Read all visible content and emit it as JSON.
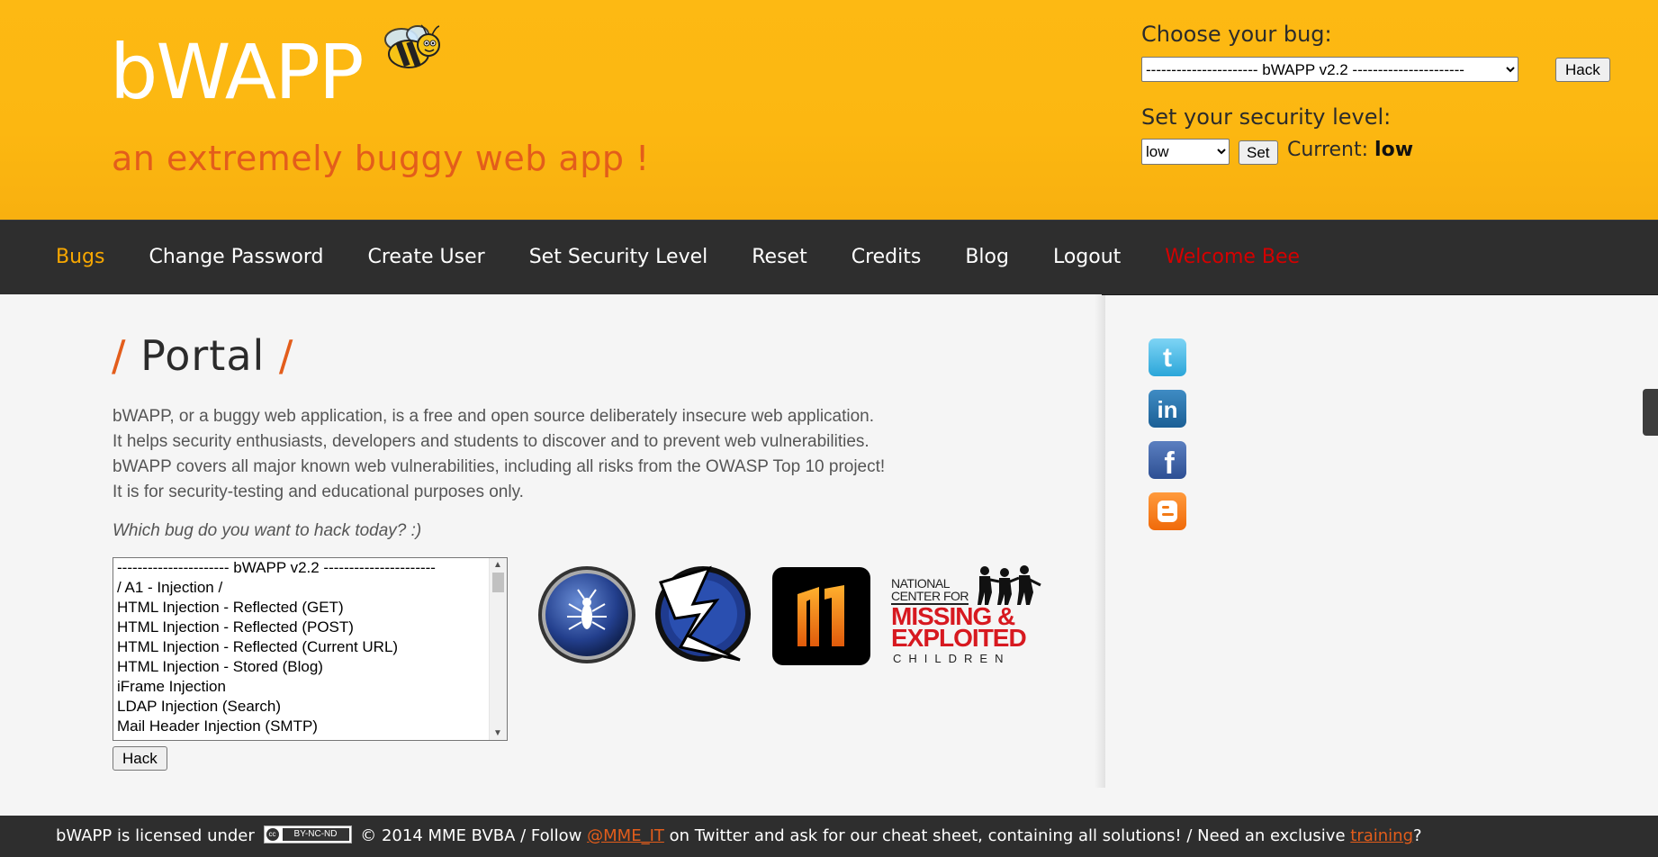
{
  "header": {
    "logo_text": "bWAPP",
    "tagline": "an extremely buggy web app !",
    "choose_label": "Choose your bug:",
    "bug_select_value": "---------------------- bWAPP v2.2 ----------------------",
    "hack_label": "Hack",
    "security_label": "Set your security level:",
    "security_select_value": "low",
    "set_label": "Set",
    "current_label": "Current:",
    "current_value": "low"
  },
  "nav": {
    "items": [
      {
        "label": "Bugs",
        "state": "active"
      },
      {
        "label": "Change Password"
      },
      {
        "label": "Create User"
      },
      {
        "label": "Set Security Level"
      },
      {
        "label": "Reset"
      },
      {
        "label": "Credits"
      },
      {
        "label": "Blog"
      },
      {
        "label": "Logout"
      },
      {
        "label": "Welcome Bee",
        "state": "welcome"
      }
    ]
  },
  "main": {
    "title_slash_left": "/",
    "title": "Portal",
    "title_slash_right": "/",
    "description": [
      "bWAPP, or a buggy web application, is a free and open source deliberately insecure web application.",
      "It helps security enthusiasts, developers and students to discover and to prevent web vulnerabilities.",
      "bWAPP covers all major known web vulnerabilities, including all risks from the OWASP Top 10 project!",
      "It is for security-testing and educational purposes only."
    ],
    "question": "Which bug do you want to hack today? :)",
    "bug_list": [
      "---------------------- bWAPP v2.2 ----------------------",
      "/ A1 - Injection /",
      "HTML Injection - Reflected (GET)",
      "HTML Injection - Reflected (POST)",
      "HTML Injection - Reflected (Current URL)",
      "HTML Injection - Stored (Blog)",
      "iFrame Injection",
      "LDAP Injection (Search)",
      "Mail Header Injection (SMTP)"
    ],
    "hack_label": "Hack",
    "ncmec_text": {
      "line1": "NATIONAL",
      "line2": "CENTER FOR",
      "line3": "MISSING &",
      "line4": "EXPLOITED",
      "line5": "CHILDREN"
    }
  },
  "footer": {
    "text_before": "bWAPP is licensed under",
    "cc_text": "BY-NC-ND",
    "cc_circle": "cc",
    "text_after": "© 2014 MME BVBA / Follow",
    "twitter_handle": "@MME_IT",
    "text_mid": "on Twitter and ask for our cheat sheet, containing all solutions! / Need an exclusive",
    "training_link": "training",
    "text_end": "?"
  },
  "colors": {
    "header_bg": "#fdb913",
    "accent_orange": "#e35d1b",
    "nav_bg": "#2e2e2e",
    "nav_active": "#f7a700",
    "nav_welcome": "#d40000"
  },
  "icons": [
    "bee-icon",
    "owasp-logo",
    "zap-logo",
    "netsparker-logo",
    "ncmec-logo",
    "twitter-icon",
    "linkedin-icon",
    "facebook-icon",
    "blogger-icon"
  ]
}
